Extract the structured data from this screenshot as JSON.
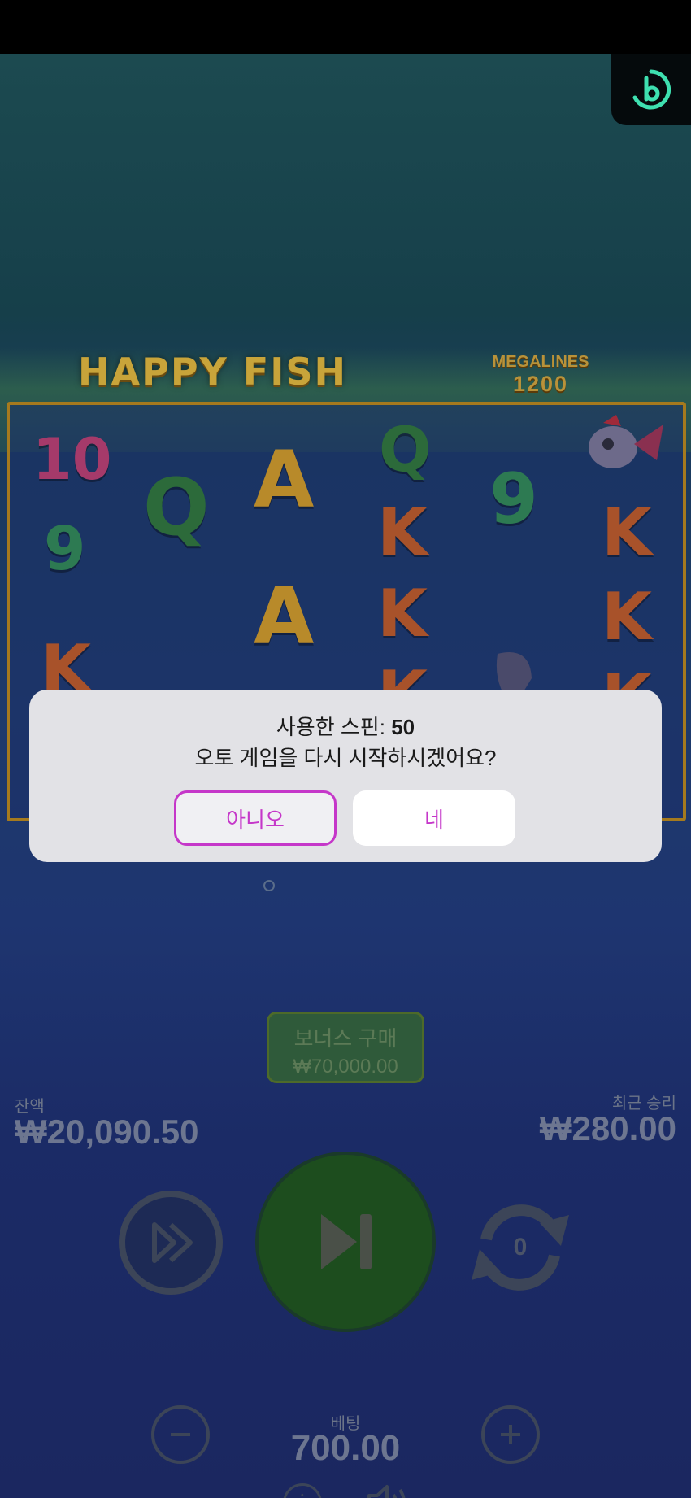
{
  "game": {
    "title": "HAPPY FISH",
    "megalines_label": "MEGALINES",
    "megalines_value": "1200"
  },
  "reels": [
    {
      "text": "10",
      "color": "#a53a6a"
    },
    {
      "text": "9",
      "color": "#2d7a52"
    },
    {
      "text": "K",
      "color": "#a8522a"
    },
    {
      "text": "Q",
      "color": "#2c6a3a"
    },
    {
      "text": "A",
      "color": "#b88a2a"
    },
    {
      "text": "A",
      "color": "#b88a2a"
    },
    {
      "text": "A",
      "color": "#b88a2a"
    },
    {
      "text": "Q",
      "color": "#2c6a3a"
    },
    {
      "text": "K",
      "color": "#a8522a"
    },
    {
      "text": "K",
      "color": "#a8522a"
    },
    {
      "text": "K",
      "color": "#a8522a"
    },
    {
      "text": "9",
      "color": "#2d7a52"
    },
    {
      "text": "K",
      "color": "#a8522a"
    },
    {
      "text": "K",
      "color": "#a8522a"
    },
    {
      "text": "K",
      "color": "#a8522a"
    }
  ],
  "bonus": {
    "label": "보너스 구매",
    "price": "₩70,000.00"
  },
  "balance": {
    "label": "잔액",
    "value": "₩20,090.50"
  },
  "last_win": {
    "label": "최근 승리",
    "value": "₩280.00"
  },
  "autoplay": {
    "count": "0"
  },
  "bet": {
    "label": "베팅",
    "value": "700.00"
  },
  "dialog": {
    "spins_label": "사용한 스핀:",
    "spins_value": "50",
    "question": "오토 게임을 다시 시작하시겠어요?",
    "no_label": "아니오",
    "yes_label": "네"
  },
  "colors": {
    "accent": "#c537c9",
    "logo": "#3ee0b0"
  },
  "icons": [
    "provider-logo-icon",
    "turbo-icon",
    "spin-icon",
    "autoplay-icon",
    "minus-icon",
    "plus-icon",
    "info-icon",
    "sound-icon"
  ]
}
